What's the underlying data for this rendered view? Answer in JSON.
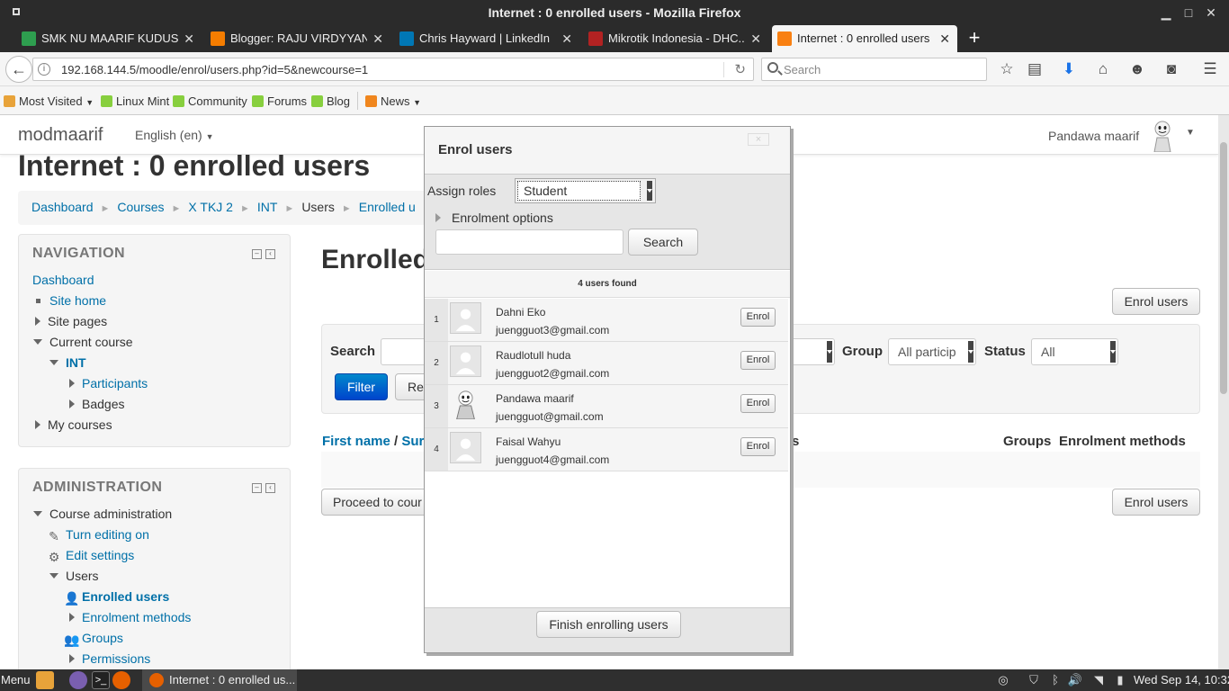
{
  "window": {
    "title": "Internet : 0 enrolled users - Mozilla Firefox"
  },
  "tabs": [
    {
      "label": "SMK NU MAARIF KUDUS",
      "fav_color": "#2e9e4f"
    },
    {
      "label": "Blogger: RAJU VIRDYYAN...",
      "fav_color": "#f57d00"
    },
    {
      "label": "Chris Hayward | LinkedIn",
      "fav_color": "#0077b5"
    },
    {
      "label": "Mikrotik Indonesia - DHC...",
      "fav_color": "#b22222"
    },
    {
      "label": "Internet : 0 enrolled users",
      "fav_color": "#f98012"
    }
  ],
  "navbar": {
    "url": "192.168.144.5/moodle/enrol/users.php?id=5&newcourse=1",
    "search_placeholder": "Search"
  },
  "bookmarks": [
    {
      "label": "Most Visited",
      "icon_color": "#e8a33a"
    },
    {
      "label": "Linux Mint",
      "icon_color": "#87cf3e"
    },
    {
      "label": "Community",
      "icon_color": "#87cf3e"
    },
    {
      "label": "Forums",
      "icon_color": "#87cf3e"
    },
    {
      "label": "Blog",
      "icon_color": "#87cf3e"
    },
    {
      "label": "News",
      "icon_color": "#f0861e"
    }
  ],
  "header": {
    "brand": "modmaarif",
    "language": "English (en)",
    "user": "Pandawa maarif"
  },
  "page": {
    "title": "Internet : 0 enrolled users",
    "breadcrumb": [
      "Dashboard",
      "Courses",
      "X TKJ 2",
      "INT",
      "Users",
      "Enrolled u"
    ],
    "heading": "Enrolled"
  },
  "navigation": {
    "title": "NAVIGATION",
    "items": [
      "Dashboard",
      "Site home",
      "Site pages",
      "Current course",
      "INT",
      "Participants",
      "Badges",
      "My courses"
    ]
  },
  "administration": {
    "title": "ADMINISTRATION",
    "items": [
      "Course administration",
      "Turn editing on",
      "Edit settings",
      "Users",
      "Enrolled users",
      "Enrolment methods",
      "Groups",
      "Permissions"
    ]
  },
  "filters": {
    "search_label": "Search",
    "group_label": "Group",
    "group_value": "All particip",
    "status_label": "Status",
    "status_value": "All",
    "filter_button": "Filter",
    "reset_button": "Re"
  },
  "buttons": {
    "enrol_users": "Enrol users",
    "proceed": "Proceed to cour"
  },
  "table": {
    "col_first": "First name",
    "col_slash": "/",
    "col_surname": "Surn",
    "col_s": "s",
    "col_groups": "Groups",
    "col_methods": "Enrolment methods"
  },
  "dialog": {
    "title": "Enrol users",
    "close": "×",
    "assign_roles_label": "Assign roles",
    "role_value": "Student",
    "enrolment_options": "Enrolment options",
    "search_button": "Search",
    "users_found": "4 users found",
    "enrol_button": "Enrol",
    "finish_button": "Finish enrolling users",
    "users": [
      {
        "num": "1",
        "name": "Dahni Eko",
        "email": "juengguot3@gmail.com",
        "avatar": "default"
      },
      {
        "num": "2",
        "name": "Raudlotull huda",
        "email": "juengguot2@gmail.com",
        "avatar": "default"
      },
      {
        "num": "3",
        "name": "Pandawa maarif",
        "email": "juengguot@gmail.com",
        "avatar": "marshmello"
      },
      {
        "num": "4",
        "name": "Faisal Wahyu",
        "email": "juengguot4@gmail.com",
        "avatar": "default"
      }
    ]
  },
  "taskbar": {
    "menu": "Menu",
    "window_label": "Internet : 0 enrolled us...",
    "clock": "Wed Sep 14, 10:32"
  },
  "colors": {
    "link": "#0070a8",
    "primary_button": "#0055cc",
    "titlebar": "#2b2b2b"
  }
}
